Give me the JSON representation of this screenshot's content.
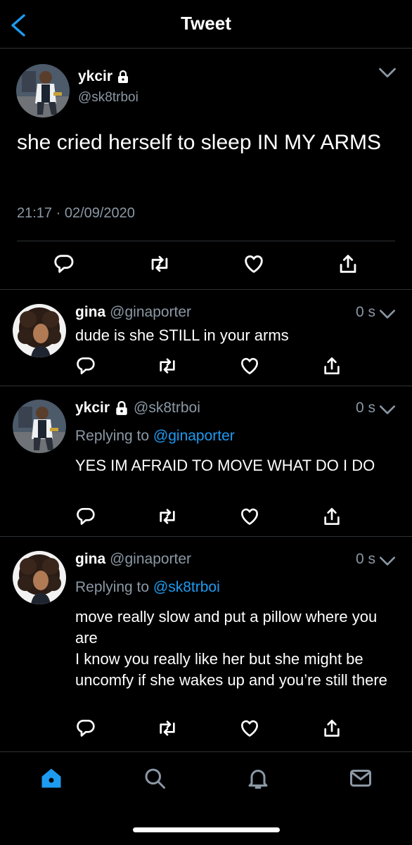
{
  "header": {
    "title": "Tweet"
  },
  "main_tweet": {
    "name": "ykcir",
    "handle": "@sk8trboi",
    "text": "she cried herself to sleep IN MY ARMS",
    "timestamp": "21:17 · 02/09/2020"
  },
  "replies": [
    {
      "name": "gina",
      "handle": "@ginaporter",
      "time": "0 s",
      "replying_to": "",
      "text": "dude is she STILL in your arms"
    },
    {
      "name": "ykcir",
      "handle": "@sk8trboi",
      "time": "0 s",
      "replying_label": "Replying to",
      "replying_to": "@ginaporter",
      "text": "YES IM AFRAID TO MOVE WHAT DO I DO"
    },
    {
      "name": "gina",
      "handle": "@ginaporter",
      "time": "0 s",
      "replying_label": "Replying to",
      "replying_to": "@sk8trboi",
      "text": "move really slow and put a pillow where you are\nI know you really like her but she might be uncomfy if she wakes up and you’re still there"
    }
  ],
  "colors": {
    "accent": "#1d9bf0",
    "secondary_text": "#8b98a5",
    "divider": "#2f3336",
    "background": "#000000"
  },
  "icons": {
    "actions": [
      "reply-icon",
      "retweet-icon",
      "like-icon",
      "share-icon"
    ],
    "tabs": [
      "home-icon",
      "search-icon",
      "notifications-icon",
      "messages-icon"
    ]
  }
}
